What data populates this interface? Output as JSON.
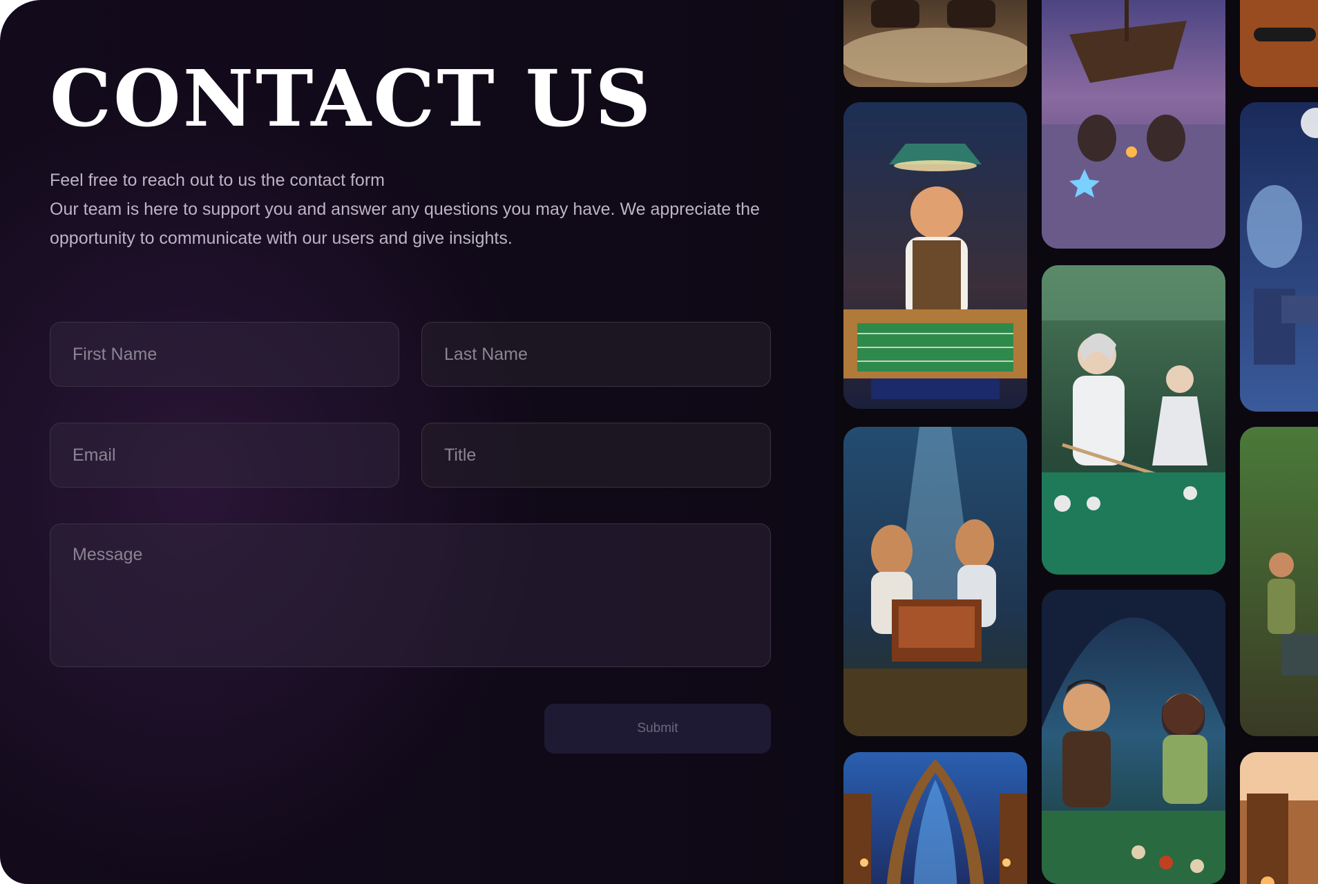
{
  "heading": "CONTACT US",
  "intro": {
    "line1": "Feel free to reach out to us the contact form",
    "line2": "Our team is here to support you and answer any questions you may have. We appreciate the opportunity to communicate with our users and give insights."
  },
  "form": {
    "first_name_placeholder": "First Name",
    "last_name_placeholder": "Last Name",
    "email_placeholder": "Email",
    "title_placeholder": "Title",
    "message_placeholder": "Message",
    "submit_label": "Submit"
  },
  "gallery": {
    "images": [
      "foosball-workshop-character",
      "seaside-shipwreck-board-game",
      "forest-elves-billiards",
      "ruined-hall-foosball-duel",
      "cave-billiards-couple",
      "cathedral-arches-scene",
      "snowy-night-chess-scene",
      "jungle-temple-foosball"
    ]
  },
  "colors": {
    "background": "#130b1c",
    "heading": "#ffffff",
    "body_text": "#bdb4c6",
    "field_border": "#3a3244",
    "submit_bg": "#1f1a33"
  }
}
